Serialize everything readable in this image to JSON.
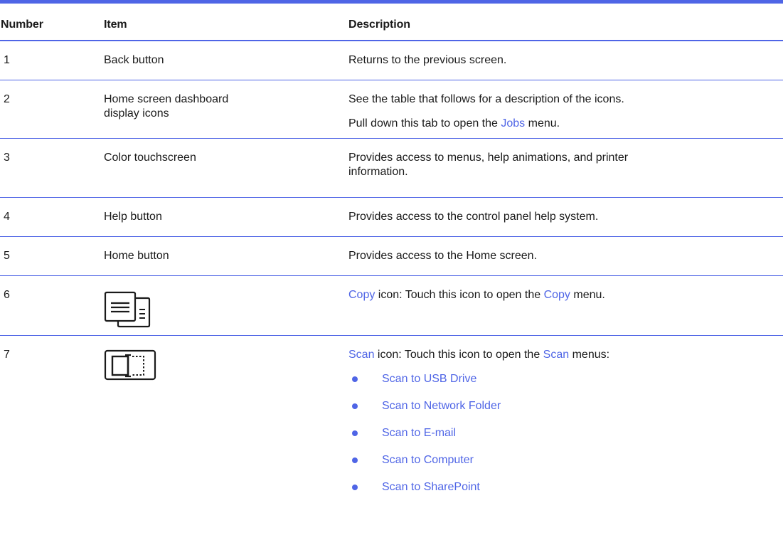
{
  "header": {
    "number": "Number",
    "item": "Item",
    "description": "Description"
  },
  "rows": [
    {
      "number": "1",
      "item": "Back button",
      "desc": "Returns to the previous screen."
    },
    {
      "number": "2",
      "item": "Home screen dashboard display icons",
      "desc": "See the table that follows for a description of the icons.",
      "desc2_prefix": "Pull down this tab to open the ",
      "desc2_link": "Jobs",
      "desc2_suffix": " menu."
    },
    {
      "number": "3",
      "item": "Color touchscreen",
      "desc": "Provides access to menus, help animations, and printer information."
    },
    {
      "number": "4",
      "item": "Help button",
      "desc": "Provides access to the control panel help system."
    },
    {
      "number": "5",
      "item": "Home button",
      "desc": "Provides access to the Home screen."
    },
    {
      "number": "6",
      "icon": "copy-icon",
      "desc_link1": "Copy",
      "desc_mid": " icon: Touch this icon to open the ",
      "desc_link2": "Copy",
      "desc_suffix": " menu."
    },
    {
      "number": "7",
      "icon": "scan-icon",
      "desc_link1": "Scan",
      "desc_mid": " icon: Touch this icon to open the ",
      "desc_link2": "Scan",
      "desc_suffix": " menus:",
      "bullets": [
        "Scan to USB Drive",
        "Scan to Network Folder",
        "Scan to E-mail",
        "Scan to Computer",
        "Scan to SharePoint"
      ]
    }
  ],
  "colors": {
    "accent": "#4f65e6",
    "text": "#1a1a1a"
  }
}
